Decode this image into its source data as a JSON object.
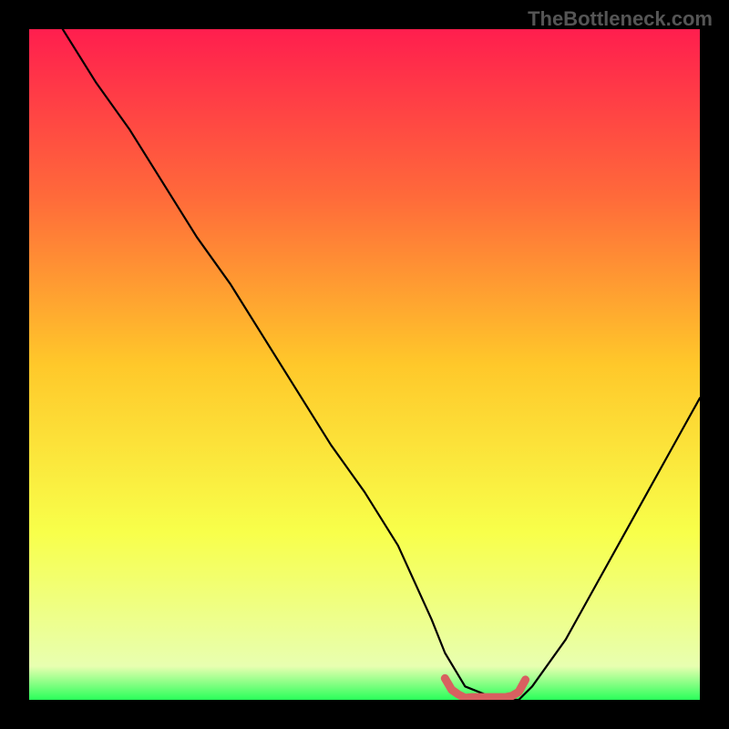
{
  "watermark": "TheBottleneck.com",
  "chart_data": {
    "type": "line",
    "title": "",
    "xlabel": "",
    "ylabel": "",
    "xlim": [
      0,
      100
    ],
    "ylim": [
      0,
      100
    ],
    "series": [
      {
        "name": "main-curve",
        "color": "#000000",
        "x": [
          5,
          10,
          15,
          20,
          25,
          30,
          35,
          40,
          45,
          50,
          55,
          60,
          62,
          65,
          70,
          73,
          75,
          80,
          85,
          90,
          95,
          100
        ],
        "values": [
          100,
          92,
          85,
          77,
          69,
          62,
          54,
          46,
          38,
          31,
          23,
          12,
          7,
          2,
          0,
          0,
          2,
          9,
          18,
          27,
          36,
          45
        ]
      },
      {
        "name": "bottom-marker",
        "color": "#d86060",
        "thick": true,
        "x": [
          62,
          63,
          64,
          65,
          66,
          67,
          68,
          69,
          70,
          71,
          72,
          73,
          74
        ],
        "values": [
          3.2,
          1.5,
          0.8,
          0.3,
          0.4,
          0.4,
          0.4,
          0.4,
          0.4,
          0.4,
          0.6,
          1.2,
          3.0
        ]
      }
    ],
    "background_gradient": {
      "stops": [
        {
          "offset": 0,
          "color": "#ff1e4e"
        },
        {
          "offset": 25,
          "color": "#ff6a3a"
        },
        {
          "offset": 50,
          "color": "#ffc82a"
        },
        {
          "offset": 75,
          "color": "#f8ff4a"
        },
        {
          "offset": 95,
          "color": "#e8ffb0"
        },
        {
          "offset": 100,
          "color": "#2aff5a"
        }
      ]
    }
  }
}
